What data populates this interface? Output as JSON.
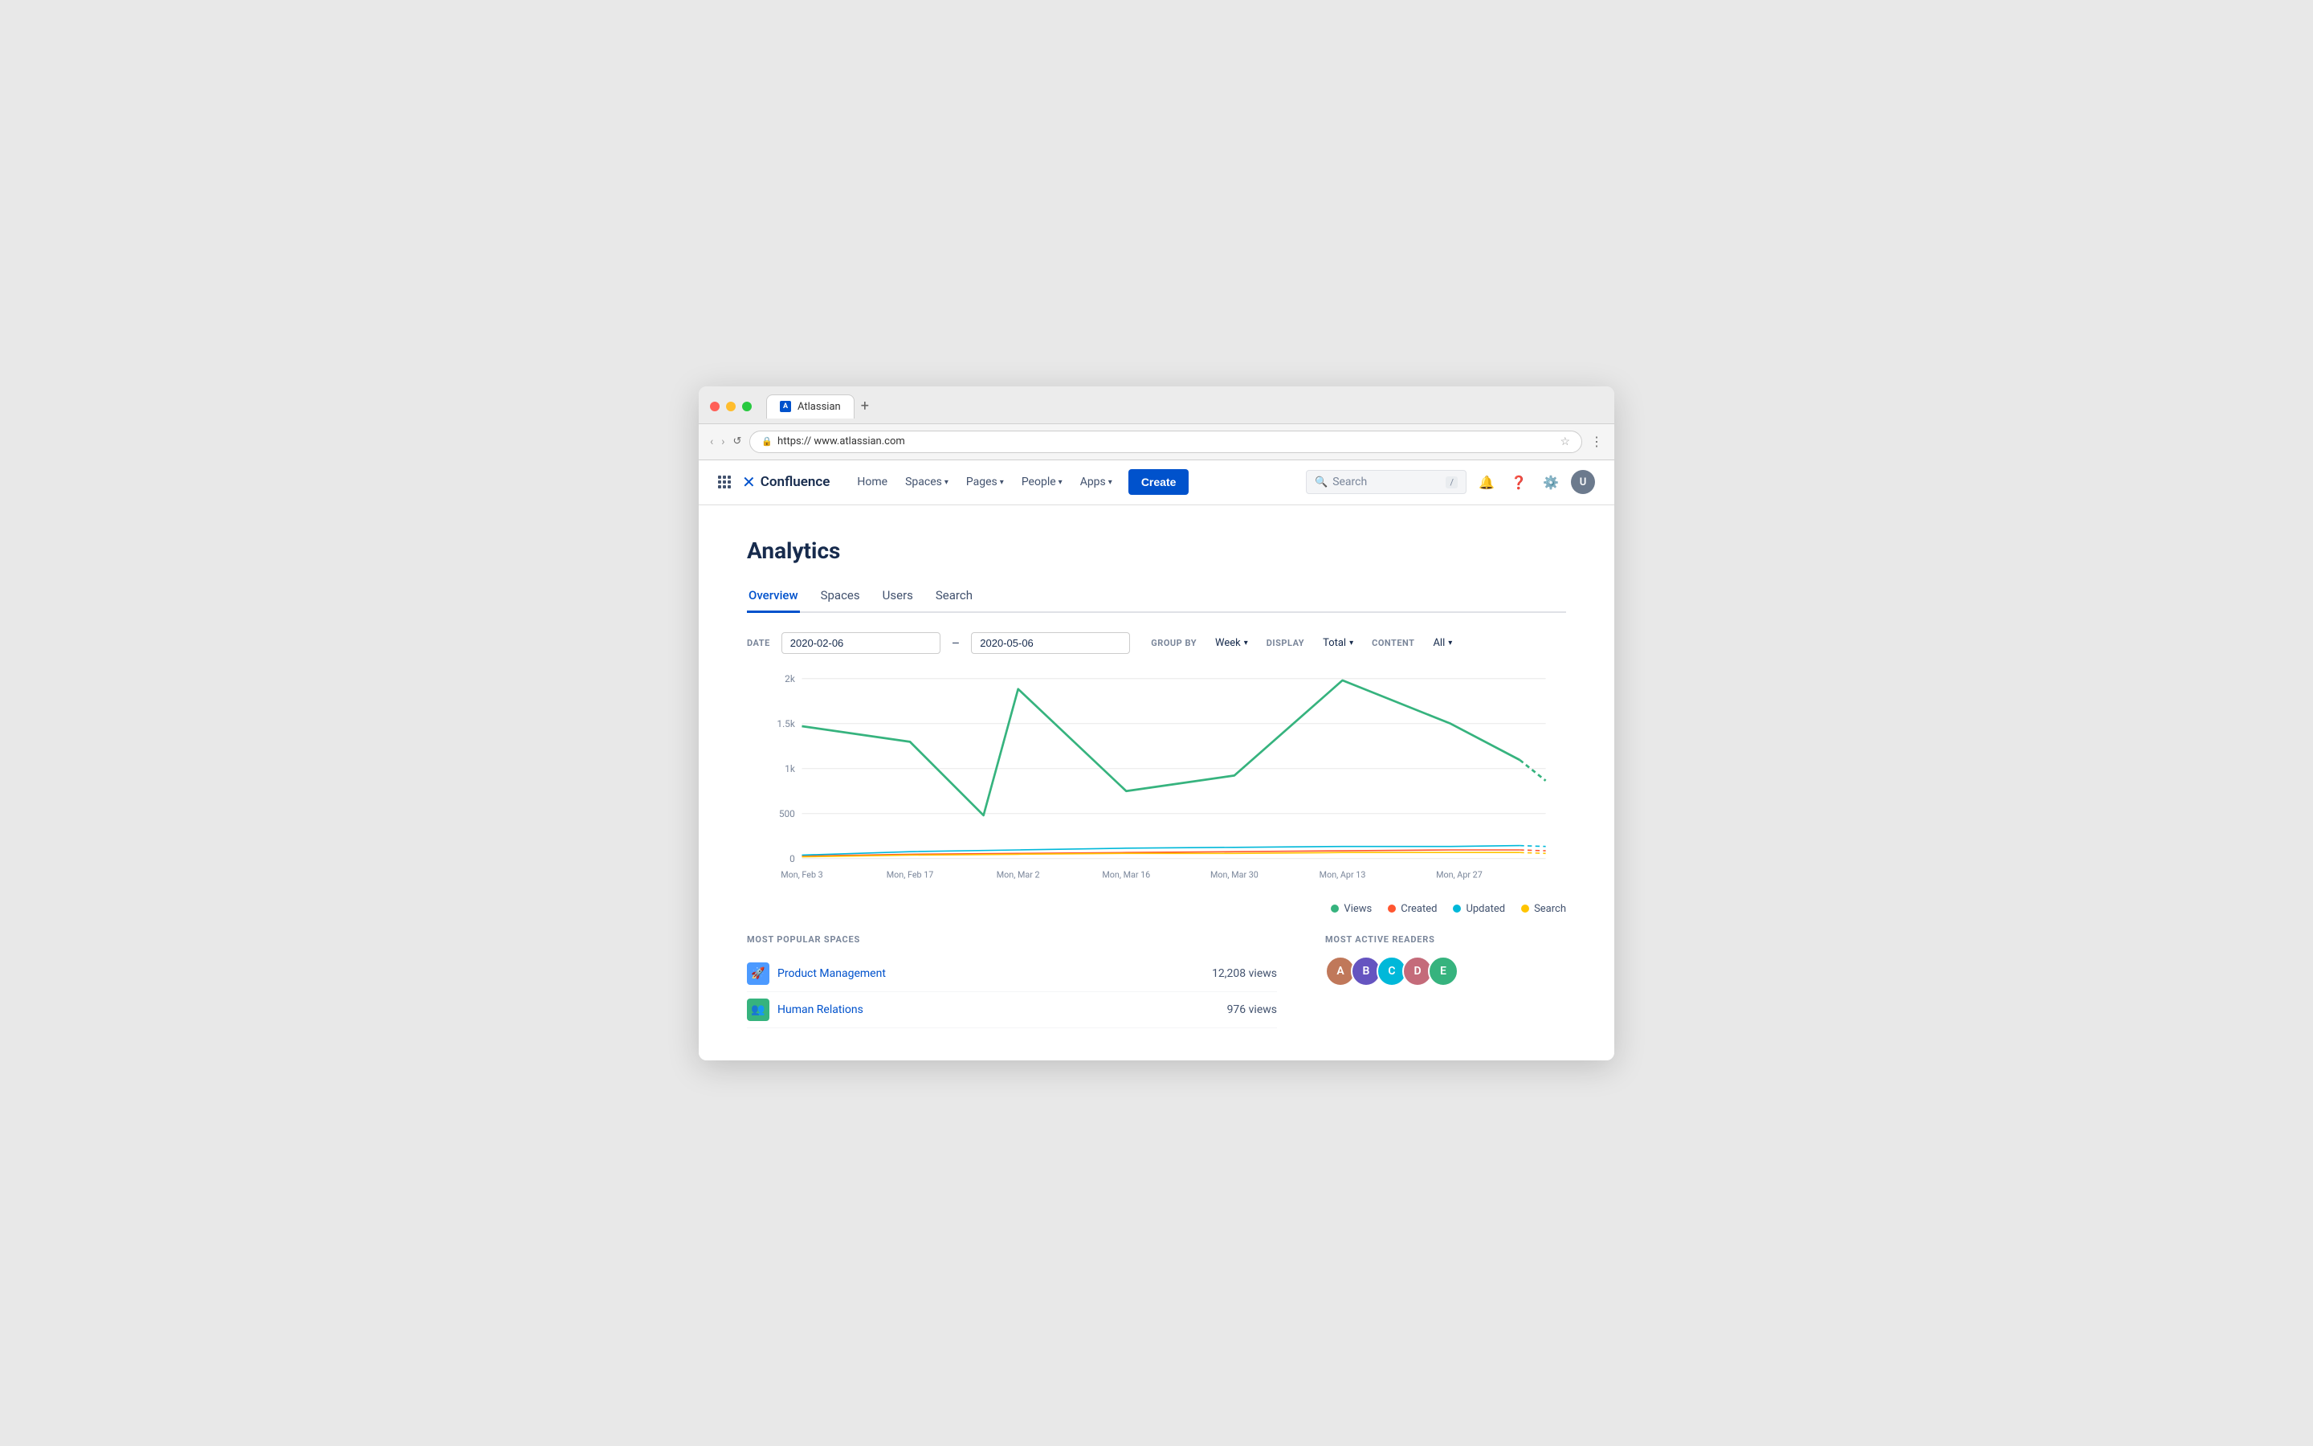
{
  "browser": {
    "url": "https:// www.atlassian.com",
    "tab_title": "Atlassian",
    "tab_plus": "+",
    "nav_back": "‹",
    "nav_forward": "›",
    "nav_refresh": "↺",
    "lock_icon": "🔒",
    "star_icon": "☆",
    "more_icon": "⋮"
  },
  "header": {
    "logo_text": "Confluence",
    "nav_items": [
      {
        "label": "Home",
        "has_chevron": false
      },
      {
        "label": "Spaces",
        "has_chevron": true
      },
      {
        "label": "Pages",
        "has_chevron": true
      },
      {
        "label": "People",
        "has_chevron": true
      },
      {
        "label": "Apps",
        "has_chevron": true
      }
    ],
    "create_label": "Create",
    "search_placeholder": "Search",
    "search_shortcut": "/"
  },
  "analytics": {
    "title": "Analytics",
    "tabs": [
      {
        "label": "Overview",
        "active": true
      },
      {
        "label": "Spaces",
        "active": false
      },
      {
        "label": "Users",
        "active": false
      },
      {
        "label": "Search",
        "active": false
      }
    ],
    "filters": {
      "date_label": "DATE",
      "date_from": "2020-02-06",
      "date_to": "2020-05-06",
      "group_by_label": "GROUP BY",
      "group_by_value": "Week",
      "display_label": "DISPLAY",
      "display_value": "Total",
      "content_label": "CONTENT",
      "content_value": "All"
    },
    "chart": {
      "y_labels": [
        "2k",
        "1.5k",
        "1k",
        "500",
        "0"
      ],
      "x_labels": [
        "Mon, Feb 3",
        "Mon, Feb 17",
        "Mon, Mar 2",
        "Mon, Mar 16",
        "Mon, Mar 30",
        "Mon, Apr 13",
        "Mon, Apr 27"
      ],
      "views_color": "#36b37e",
      "created_color": "#ff5630",
      "updated_color": "#00b8d9",
      "search_color": "#ffc400"
    },
    "legend": [
      {
        "label": "Views",
        "color": "#36b37e"
      },
      {
        "label": "Created",
        "color": "#ff5630"
      },
      {
        "label": "Updated",
        "color": "#00b8d9"
      },
      {
        "label": "Search",
        "color": "#ffc400"
      }
    ],
    "most_popular_spaces": {
      "section_title": "MOST POPULAR SPACES",
      "spaces": [
        {
          "name": "Product Management",
          "views": "12,208 views",
          "icon": "🚀",
          "icon_bg": "#4c9aff"
        },
        {
          "name": "Human Relations",
          "views": "976 views",
          "icon": "👥",
          "icon_bg": "#36b37e"
        }
      ]
    },
    "most_active_readers": {
      "section_title": "MOST ACTIVE READERS",
      "readers": [
        {
          "initials": "A",
          "bg": "#ff7452"
        },
        {
          "initials": "B",
          "bg": "#6554c0"
        },
        {
          "initials": "C",
          "bg": "#00b8d9"
        },
        {
          "initials": "D",
          "bg": "#ff5630"
        },
        {
          "initials": "E",
          "bg": "#36b37e"
        }
      ]
    }
  }
}
